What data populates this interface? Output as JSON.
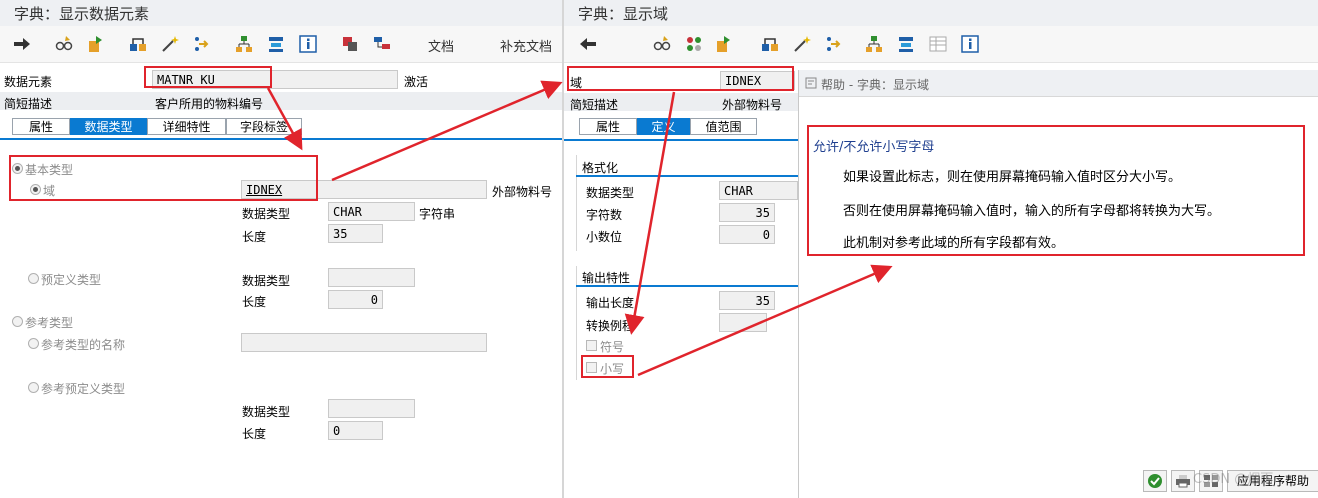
{
  "left": {
    "title": "字典：显示数据元素",
    "toolbar": {
      "doc_label": "文档",
      "supp_doc_label": "补充文档"
    },
    "element_label": "数据元素",
    "element_value": "MATNR_KU",
    "status": "激活",
    "short_desc_label": "简短描述",
    "short_desc_value": "客户所用的物料编号",
    "tabs": [
      "属性",
      "数据类型",
      "详细特性",
      "字段标签"
    ],
    "active_tab": 1,
    "basic_type_label": "基本类型",
    "domain_label": "域",
    "domain_value": "IDNEX",
    "domain_desc": "外部物料号",
    "data_type_label": "数据类型",
    "data_type_value": "CHAR",
    "data_type_desc": "字符串",
    "length_label": "长度",
    "length_value": "35",
    "predefined_label": "预定义类型",
    "pre_data_type_label": "数据类型",
    "pre_length_label": "长度",
    "pre_length_value": "0",
    "ref_type_label": "参考类型",
    "ref_type_name_label": "参考类型的名称",
    "ref_predef_label": "参考预定义类型",
    "ref_data_type_label": "数据类型",
    "ref_length_label": "长度",
    "ref_length_value": "0"
  },
  "right": {
    "title": "字典：显示域",
    "domain_label": "域",
    "domain_value": "IDNEX",
    "short_desc_label": "简短描述",
    "short_desc_value": "外部物料号",
    "tabs": [
      "属性",
      "定义",
      "值范围"
    ],
    "active_tab": 1,
    "format_title": "格式化",
    "data_type_label": "数据类型",
    "data_type_value": "CHAR",
    "char_count_label": "字符数",
    "char_count_value": "35",
    "decimals_label": "小数位",
    "decimals_value": "0",
    "output_title": "输出特性",
    "output_len_label": "输出长度",
    "output_len_value": "35",
    "conv_label": "转换例程",
    "sign_label": "符号",
    "lower_label": "小写"
  },
  "help": {
    "title": "帮助 - 字典：显示域",
    "heading": "允许/不允许小写字母",
    "lines": [
      "如果设置此标志，则在使用屏幕掩码输入值时区分大小写。",
      "否则在使用屏幕掩码输入值时，输入的所有字母都将转换为大写。",
      "此机制对参考此域的所有字段都有效。"
    ],
    "footer_button": "应用程序帮助",
    "watermark": "CSDN @烟雨"
  },
  "colors": {
    "accent": "#0a7ad1",
    "highlight": "#e0242c"
  }
}
